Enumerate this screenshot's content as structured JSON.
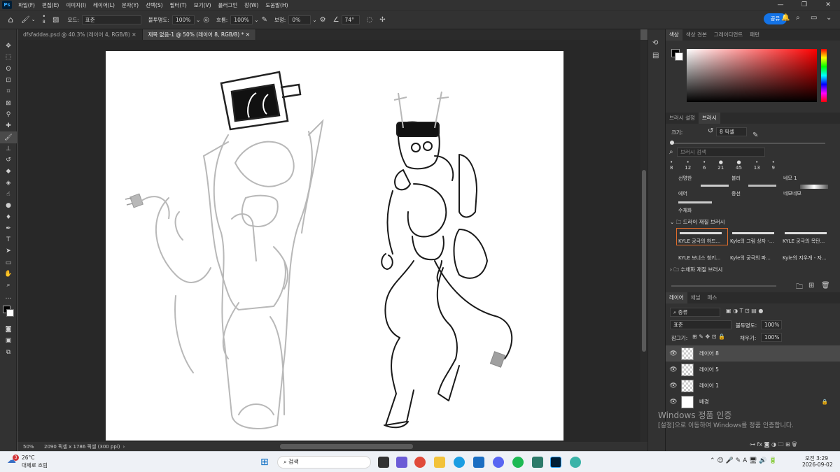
{
  "menu": {
    "logo": "Ps",
    "items": [
      "파일(F)",
      "편집(E)",
      "이미지(I)",
      "레이어(L)",
      "문자(Y)",
      "선택(S)",
      "필터(T)",
      "보기(V)",
      "플러그인",
      "창(W)",
      "도움말(H)"
    ]
  },
  "options": {
    "brush_size": "8",
    "mode_label": "모드:",
    "mode_value": "표준",
    "opacity_label": "불투명도:",
    "opacity_value": "100%",
    "flow_label": "흐름:",
    "flow_value": "100%",
    "smoothing_label": "보정:",
    "smoothing_value": "0%",
    "angle_value": "74°",
    "share_label": "공유"
  },
  "tabs": [
    {
      "label": "dfsfaddas.psd @ 40.3% (레이어 4, RGB/8)"
    },
    {
      "label": "제목 없음-1 @ 50% (레이어 8, RGB/8) *"
    }
  ],
  "status": {
    "zoom": "50%",
    "doc_info": "2090 픽셀 x 1786 픽셀 (300 ppi)"
  },
  "color_panel": {
    "tabs": [
      "색상",
      "색상 견본",
      "그레이디언트",
      "패턴"
    ],
    "accent": "#ff0000"
  },
  "brush_panel": {
    "tabs": [
      "브러시 설정",
      "브러시"
    ],
    "size_label": "크기:",
    "size_value": "8 픽셀",
    "search_placeholder": "브러시 검색",
    "preset_sizes": [
      "8",
      "12",
      "6",
      "21",
      "45",
      "13",
      "9"
    ],
    "rows": [
      [
        "선명한",
        "블러",
        "네모 1"
      ],
      [
        "에어",
        "중선",
        "네모네모"
      ],
      [
        "수채화"
      ]
    ],
    "group_dry": "드라이 재질 브러시",
    "dry_items": [
      "KYLE 궁극의 하드...",
      "Kyle의 그림 상자 -...",
      "KYLE 궁극의 목탄...",
      "KYLE 보너스 청키...",
      "Kyle의 궁극의 파...",
      "Kyle의 지우개 - 자..."
    ],
    "group_water": "수채화 재질 브러시"
  },
  "layers_panel": {
    "tabs": [
      "레이어",
      "채널",
      "패스"
    ],
    "filter_label": "종류",
    "blend_mode": "표준",
    "opacity_label": "불투명도:",
    "opacity_value": "100%",
    "lock_label": "잠그기:",
    "fill_label": "채우기:",
    "fill_value": "100%",
    "layers": [
      {
        "name": "레이어 8"
      },
      {
        "name": "레이어 5"
      },
      {
        "name": "레이어 1"
      },
      {
        "name": "배경"
      }
    ]
  },
  "watermark": {
    "title": "Windows 정품 인증",
    "subtitle": "[설정]으로 이동하여 Windows를 정품 인증합니다."
  },
  "taskbar": {
    "weather_temp": "26°C",
    "weather_desc": "대체로 흐림",
    "weather_badge": "3",
    "search_label": "검색",
    "time": "오전 3:29",
    "date": "2026-09-02"
  }
}
